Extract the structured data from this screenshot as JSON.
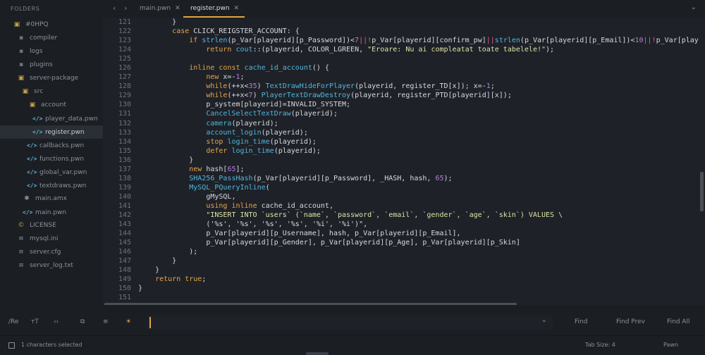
{
  "sidebar": {
    "title": "FOLDERS",
    "items": [
      {
        "label": "#0HPQ",
        "icon": "folder-open-icon"
      },
      {
        "label": "compiler",
        "icon": "folder-icon"
      },
      {
        "label": "logs",
        "icon": "folder-icon"
      },
      {
        "label": "plugins",
        "icon": "folder-icon"
      },
      {
        "label": "server-package",
        "icon": "folder-open-icon"
      },
      {
        "label": "src",
        "icon": "folder-open-icon"
      },
      {
        "label": "account",
        "icon": "folder-open-icon"
      },
      {
        "label": "player_data.pwn",
        "icon": "code-file-icon"
      },
      {
        "label": "register.pwn",
        "icon": "code-file-icon"
      },
      {
        "label": "callbacks.pwn",
        "icon": "code-file-icon"
      },
      {
        "label": "functions.pwn",
        "icon": "code-file-icon"
      },
      {
        "label": "global_var.pwn",
        "icon": "code-file-icon"
      },
      {
        "label": "textdraws.pwn",
        "icon": "code-file-icon"
      },
      {
        "label": "main.amx",
        "icon": "asterisk-file-icon"
      },
      {
        "label": "main.pwn",
        "icon": "code-file-icon"
      },
      {
        "label": "LICENSE",
        "icon": "license-icon"
      },
      {
        "label": "mysql.ini",
        "icon": "text-file-icon"
      },
      {
        "label": "server.cfg",
        "icon": "text-file-icon"
      },
      {
        "label": "server_log.txt",
        "icon": "text-file-icon"
      }
    ]
  },
  "tabs": [
    {
      "label": "main.pwn",
      "close": "✕"
    },
    {
      "label": "register.pwn",
      "close": "✕"
    }
  ],
  "nav": {
    "back": "‹",
    "forward": "›",
    "overflow": "⌄"
  },
  "editor": {
    "line_numbers": [
      "121",
      "122",
      "123",
      "124",
      "125",
      "126",
      "127",
      "128",
      "129",
      "130",
      "131",
      "132",
      "133",
      "134",
      "135",
      "136",
      "137",
      "138",
      "139",
      "140",
      "141",
      "142",
      "143",
      "144",
      "145",
      "146",
      "147",
      "148",
      "149",
      "150",
      "151"
    ],
    "lines": [
      "        }",
      "        case CLICK_REIGSTER_ACCOUNT: {",
      "            if strlen(p_Var[playerid][p_Password])<7||!p_Var[playerid][confirm_pw]||strlen(p_Var[playerid][p_Email])<10||!p_Var[play",
      "                return cout::(playerid, COLOR_LGREEN, \"Eroare: Nu ai compleatat toate tabelele!\");",
      "",
      "            inline const cache_id_account() {",
      "                new x=-1;",
      "                while(++x<35) TextDrawHideForPlayer(playerid, register_TD[x]); x=-1;",
      "                while(++x<7) PlayerTextDrawDestroy(playerid, register_PTD[playerid][x]);",
      "                p_system[playerid]=INVALID_SYSTEM;",
      "                CancelSelectTextDraw(playerid);",
      "                camera(playerid);",
      "                account_login(playerid);",
      "                stop login_time(playerid);",
      "                defer login_time(playerid);",
      "            }",
      "            new hash[65];",
      "            SHA256_PassHash(p_Var[playerid][p_Password], _HASH, hash, 65);",
      "            MySQL_PQueryInline(",
      "                gMySQL,",
      "                using inline cache_id_account,",
      "                \"INSERT INTO `users` (`name`, `password`, `email`, `gender`, `age`, `skin`) VALUES \\",
      "                ('%s', '%s', '%s', '%s', '%i', '%i')\",",
      "                p_Var[playerid][p_Username], hash, p_Var[playerid][p_Email],",
      "                p_Var[playerid][p_Gender], p_Var[playerid][p_Age], p_Var[playerid][p_Skin]",
      "            );",
      "        }",
      "    }",
      "    return true;",
      "}",
      ""
    ]
  },
  "find": {
    "icons": [
      "/Re",
      "ᴛT",
      "‹›",
      "⧉",
      "≡",
      "☀"
    ],
    "value": "",
    "chevron": "⌄",
    "buttons": [
      "Find",
      "Find Prev",
      "Find All"
    ]
  },
  "status": {
    "selection": "1 characters selected",
    "tab_size": "Tab Size: 4",
    "syntax": "Pawn"
  },
  "colors": {
    "accent": "#e0a541",
    "keyword": "#e6a64c",
    "function": "#51b7e0",
    "number": "#b77ee0",
    "string": "#dde3a7"
  }
}
